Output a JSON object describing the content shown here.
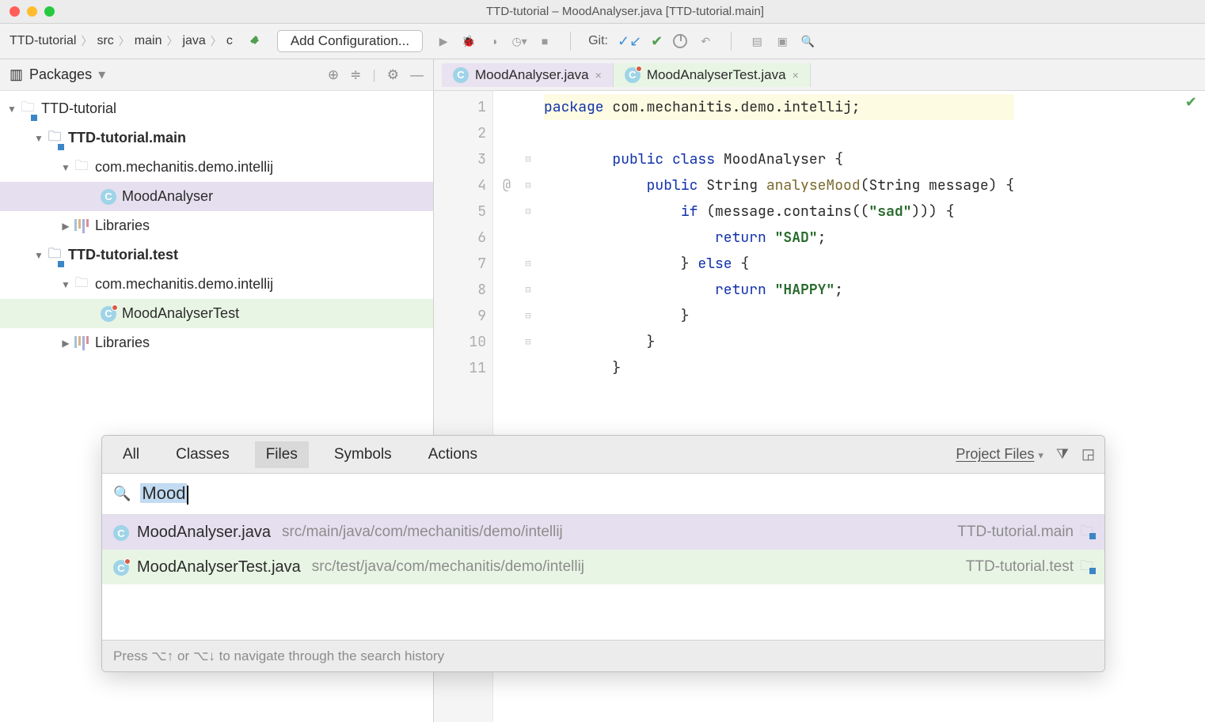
{
  "window": {
    "title": "TTD-tutorial – MoodAnalyser.java [TTD-tutorial.main]"
  },
  "breadcrumb": [
    "TTD-tutorial",
    "src",
    "main",
    "java",
    "c"
  ],
  "toolbar": {
    "add_configuration": "Add Configuration...",
    "git_label": "Git:"
  },
  "sidebar": {
    "header": "Packages",
    "tree": [
      {
        "indent": 0,
        "twisty": "▼",
        "icon": "module",
        "label": "TTD-tutorial",
        "bold": false
      },
      {
        "indent": 1,
        "twisty": "▼",
        "icon": "module",
        "label": "TTD-tutorial.main",
        "bold": true
      },
      {
        "indent": 2,
        "twisty": "▼",
        "icon": "folder",
        "label": "com.mechanitis.demo.intellij",
        "bold": false
      },
      {
        "indent": 3,
        "twisty": "",
        "icon": "class",
        "label": "MoodAnalyser",
        "bold": false,
        "sel": true
      },
      {
        "indent": 2,
        "twisty": "▶",
        "icon": "lib",
        "label": "Libraries",
        "bold": false
      },
      {
        "indent": 1,
        "twisty": "▼",
        "icon": "module",
        "label": "TTD-tutorial.test",
        "bold": true
      },
      {
        "indent": 2,
        "twisty": "▼",
        "icon": "folder",
        "label": "com.mechanitis.demo.intellij",
        "bold": false
      },
      {
        "indent": 3,
        "twisty": "",
        "icon": "class-test",
        "label": "MoodAnalyserTest",
        "bold": false,
        "grn": true
      },
      {
        "indent": 2,
        "twisty": "▶",
        "icon": "lib",
        "label": "Libraries",
        "bold": false
      }
    ]
  },
  "editor": {
    "tabs": [
      {
        "label": "MoodAnalyser.java",
        "kind": "class",
        "style": "active1"
      },
      {
        "label": "MoodAnalyserTest.java",
        "kind": "class-test",
        "style": "active2"
      }
    ],
    "line_numbers": [
      "1",
      "2",
      "3",
      "4",
      "5",
      "6",
      "7",
      "8",
      "9",
      "10",
      "11"
    ],
    "annotations": {
      "4": "@"
    },
    "code": {
      "l1": {
        "pre": "",
        "package_kw": "package",
        "rest": " com.mechanitis.demo.intellij;"
      },
      "l3": {
        "pre": "        ",
        "public_kw": "public class",
        "rest": " MoodAnalyser {"
      },
      "l4": {
        "pre": "            ",
        "public_kw": "public",
        "t1": " String ",
        "mname": "analyseMood",
        "rest": "(String message) {"
      },
      "l5": {
        "pre": "                ",
        "if_kw": "if",
        "t1": " (message.contains((",
        "str": "\"sad\"",
        "rest": "))) {"
      },
      "l6": {
        "pre": "                    ",
        "ret_kw": "return ",
        "str": "\"SAD\"",
        "rest": ";"
      },
      "l7": {
        "pre": "                } ",
        "else_kw": "else",
        "rest": " {"
      },
      "l8": {
        "pre": "                    ",
        "ret_kw": "return ",
        "str": "\"HAPPY\"",
        "rest": ";"
      },
      "l9": "                }",
      "l10": "            }",
      "l11": "        }"
    }
  },
  "popup": {
    "tabs": [
      "All",
      "Classes",
      "Files",
      "Symbols",
      "Actions"
    ],
    "active_tab": "Files",
    "scope": "Project Files",
    "query": "Mood",
    "results": [
      {
        "icon": "class",
        "name": "MoodAnalyser.java",
        "path": "src/main/java/com/mechanitis/demo/intellij",
        "module": "TTD-tutorial.main",
        "sel": true
      },
      {
        "icon": "class-test",
        "name": "MoodAnalyserTest.java",
        "path": "src/test/java/com/mechanitis/demo/intellij",
        "module": "TTD-tutorial.test",
        "grn": true
      }
    ],
    "footer": "Press ⌥↑ or ⌥↓ to navigate through the search history"
  }
}
